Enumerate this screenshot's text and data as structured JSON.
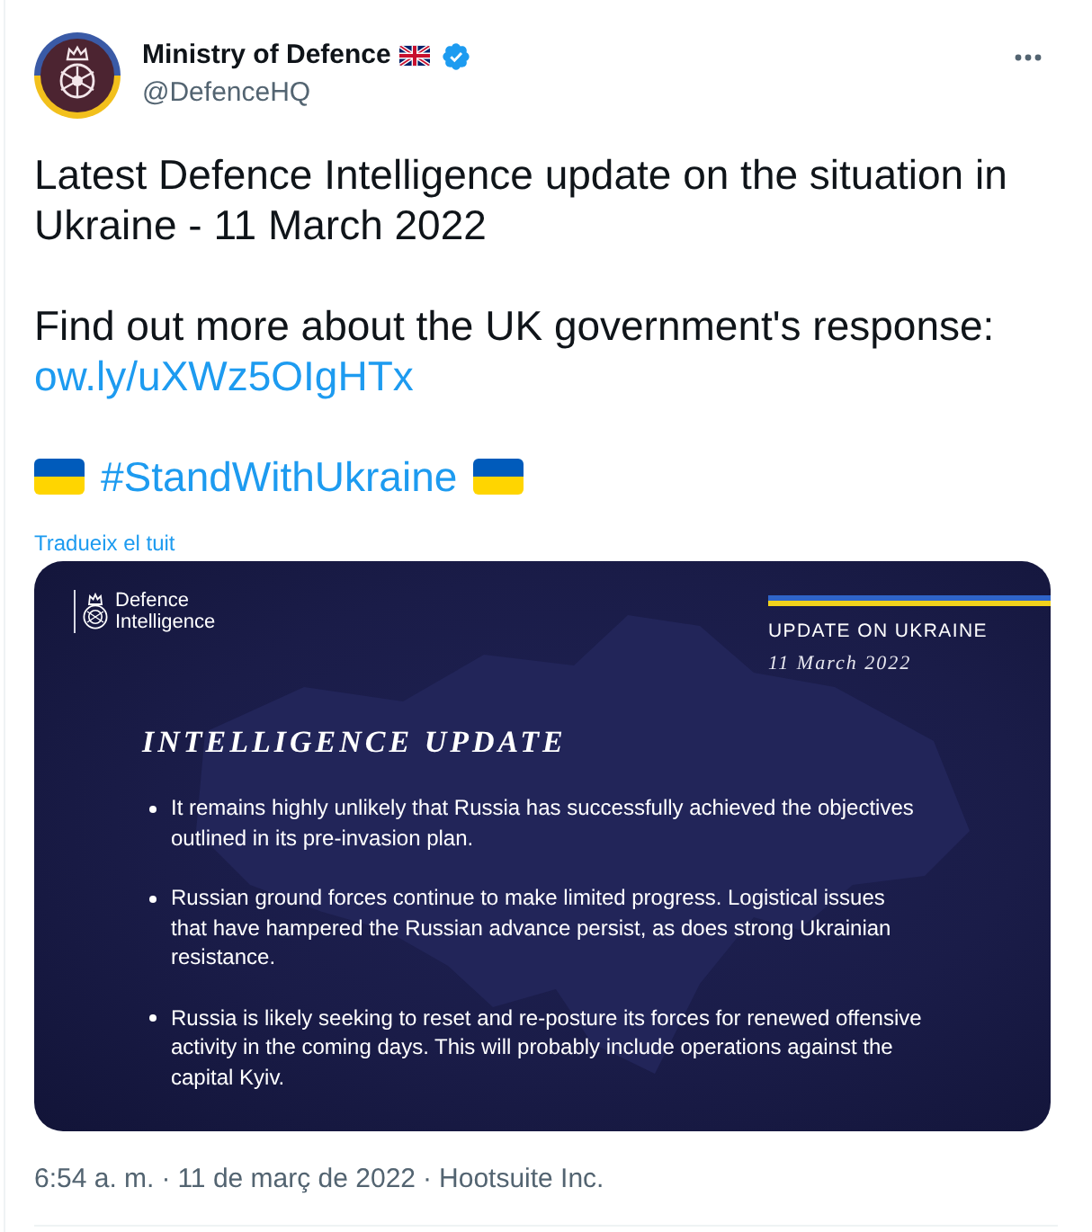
{
  "author": {
    "name": "Ministry of Defence",
    "handle": "@DefenceHQ",
    "verified": true
  },
  "text": {
    "paragraphs": [
      {
        "text": "Latest Defence Intelligence update on the situation in Ukraine - 11 March 2022"
      },
      {
        "text": "Find out more about the UK government's response:",
        "link": "ow.ly/uXWz5OIgHTx"
      }
    ],
    "hashtag": "#StandWithUkraine",
    "translate": "Tradueix el tuit"
  },
  "image": {
    "logo_text": "Defence Intelligence",
    "label": "UPDATE ON UKRAINE",
    "date": "11 March 2022",
    "heading": "INTELLIGENCE UPDATE",
    "bullets": [
      {
        "lines": [
          "It remains highly unlikely that Russia has successfully achieved the objectives",
          "outlined in its pre-invasion plan."
        ]
      },
      {
        "lines": [
          "Russian ground forces continue to make limited progress. Logistical issues",
          "that have hampered the Russian advance persist, as does strong Ukrainian",
          "resistance."
        ]
      },
      {
        "lines": [
          "Russia is likely seeking to reset and re-posture its forces for renewed offensive",
          "activity in the coming days. This will probably include operations against the",
          "capital Kyiv."
        ]
      }
    ]
  },
  "meta": [
    {
      "text": "6:54 a. m."
    },
    {
      "separator": "·",
      "text": "11 de març de 2022"
    },
    {
      "separator": "·",
      "text": "Hootsuite Inc."
    }
  ]
}
